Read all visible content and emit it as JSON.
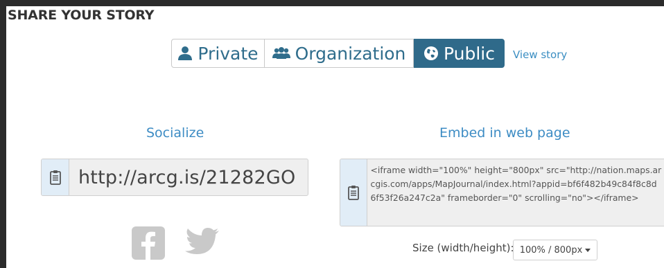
{
  "header": {
    "title": "SHARE YOUR STORY"
  },
  "visibility": {
    "private_label": "Private",
    "organization_label": "Organization",
    "public_label": "Public",
    "selected": "Public",
    "view_story": "View story"
  },
  "socialize": {
    "heading": "Socialize",
    "url": "http://arcg.is/21282GO"
  },
  "embed": {
    "heading": "Embed in web page",
    "code": "<iframe width=\"100%\" height=\"800px\" src=\"http://nation.maps.arcgis.com/apps/MapJournal/index.html?appid=bf6f482b49c84f8c8d6f53f26a247c2a\" frameborder=\"0\" scrolling=\"no\"></iframe>",
    "size_label": "Size (width/height):",
    "size_value": "100% / 800px"
  },
  "icons": {
    "private": "user-icon",
    "organization": "group-icon",
    "public": "globe-icon",
    "copy": "clipboard-icon",
    "facebook": "facebook-icon",
    "twitter": "twitter-icon"
  },
  "colors": {
    "accent": "#2f6a8a",
    "link": "#3b8ec2",
    "icon_gray": "#c9c9c9"
  }
}
